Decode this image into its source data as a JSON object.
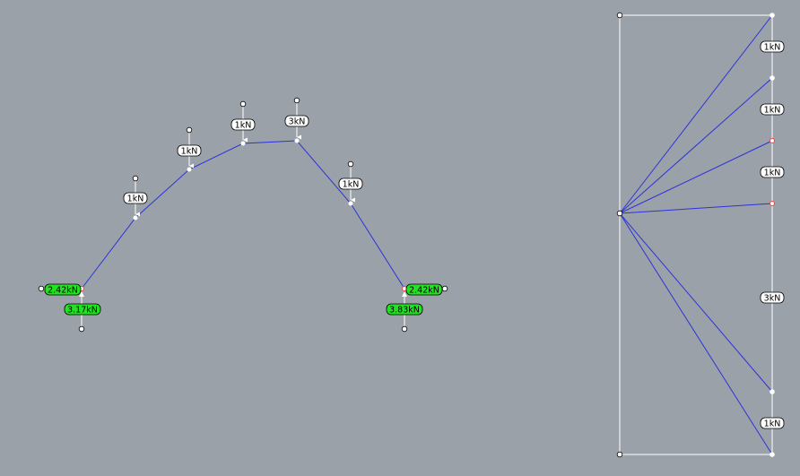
{
  "colors": {
    "background": "#9ba1a8",
    "funicular": "#2b33d9",
    "force_polygon": "#2b33d9",
    "frame": "#ffffff",
    "load_label_fill": "#ffffff",
    "reaction_label_fill": "#22e322",
    "label_border": "#000000",
    "closing_node": "#ff4040"
  },
  "form_diagram": {
    "loads": [
      {
        "label": "1kN"
      },
      {
        "label": "1kN"
      },
      {
        "label": "1kN"
      },
      {
        "label": "3kN"
      },
      {
        "label": "1kN"
      }
    ],
    "reactions": {
      "left_horizontal": "2.42kN",
      "left_vertical": "3.17kN",
      "right_horizontal": "2.42kN",
      "right_vertical": "3.83kN"
    }
  },
  "force_diagram": {
    "load_labels": [
      "1kN",
      "1kN",
      "1kN",
      "3kN",
      "1kN"
    ]
  }
}
